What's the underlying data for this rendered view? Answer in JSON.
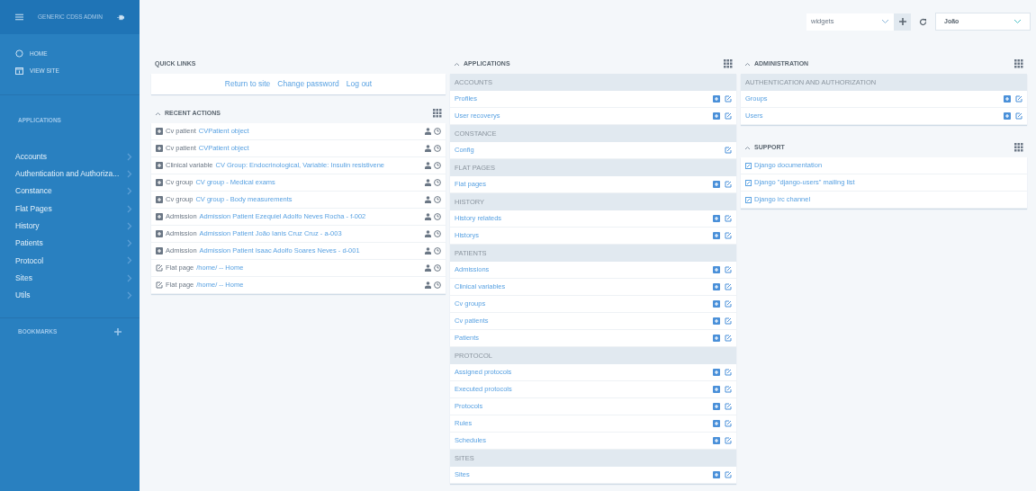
{
  "sidebar": {
    "title": "GENERIC CDSS ADMIN",
    "nav": [
      {
        "label": "HOME",
        "kind": "home"
      },
      {
        "label": "VIEW SITE",
        "kind": "site"
      }
    ],
    "apps_heading": "APPLICATIONS",
    "apps": [
      "Accounts",
      "Authentication and Authoriza...",
      "Constance",
      "Flat Pages",
      "History",
      "Patients",
      "Protocol",
      "Sites",
      "Utils"
    ],
    "bookmarks_heading": "BOOKMARKS"
  },
  "topbar": {
    "widgets_select": "widgets",
    "user_select": "João"
  },
  "quick_links": {
    "title": "QUICK LINKS",
    "links": [
      "Return to site",
      "Change password",
      "Log out"
    ]
  },
  "recent_actions": {
    "title": "RECENT ACTIONS",
    "rows": [
      {
        "kind": "add",
        "type": "Cv patient",
        "object": "CVPatient object"
      },
      {
        "kind": "add",
        "type": "Cv patient",
        "object": "CVPatient object"
      },
      {
        "kind": "add",
        "type": "Clinical variable",
        "object": "CV Group: Endocrinological, Variable: Insulin resistivene"
      },
      {
        "kind": "add",
        "type": "Cv group",
        "object": "CV group - Medical exams"
      },
      {
        "kind": "add",
        "type": "Cv group",
        "object": "CV group - Body measurements"
      },
      {
        "kind": "add",
        "type": "Admission",
        "object": "Admission Patient Ezequiel Adolfo Neves Rocha - f-002"
      },
      {
        "kind": "add",
        "type": "Admission",
        "object": "Admission Patient João Ianis Cruz Cruz - a-003"
      },
      {
        "kind": "add",
        "type": "Admission",
        "object": "Admission Patient Isaac Adolfo Soares Neves - d-001"
      },
      {
        "kind": "change",
        "type": "Flat page",
        "object": "/home/ -- Home"
      },
      {
        "kind": "change",
        "type": "Flat page",
        "object": "/home/ -- Home"
      }
    ]
  },
  "applications": {
    "title": "APPLICATIONS",
    "groups": [
      {
        "name": "ACCOUNTS",
        "models": [
          {
            "label": "Profiles",
            "can_add": true
          },
          {
            "label": "User recoverys",
            "can_add": true
          }
        ]
      },
      {
        "name": "CONSTANCE",
        "models": [
          {
            "label": "Config",
            "can_add": false
          }
        ]
      },
      {
        "name": "FLAT PAGES",
        "models": [
          {
            "label": "Flat pages",
            "can_add": true
          }
        ]
      },
      {
        "name": "HISTORY",
        "models": [
          {
            "label": "History relateds",
            "can_add": true
          },
          {
            "label": "Historys",
            "can_add": true
          }
        ]
      },
      {
        "name": "PATIENTS",
        "models": [
          {
            "label": "Admissions",
            "can_add": true
          },
          {
            "label": "Clinical variables",
            "can_add": true
          },
          {
            "label": "Cv groups",
            "can_add": true
          },
          {
            "label": "Cv patients",
            "can_add": true
          },
          {
            "label": "Patients",
            "can_add": true
          }
        ]
      },
      {
        "name": "PROTOCOL",
        "models": [
          {
            "label": "Assigned protocols",
            "can_add": true
          },
          {
            "label": "Executed protocols",
            "can_add": true
          },
          {
            "label": "Protocols",
            "can_add": true
          },
          {
            "label": "Rules",
            "can_add": true
          },
          {
            "label": "Schedules",
            "can_add": true
          }
        ]
      },
      {
        "name": "SITES",
        "models": [
          {
            "label": "Sites",
            "can_add": true
          }
        ]
      }
    ]
  },
  "administration": {
    "title": "ADMINISTRATION",
    "groups": [
      {
        "name": "AUTHENTICATION AND AUTHORIZATION",
        "models": [
          {
            "label": "Groups",
            "can_add": true
          },
          {
            "label": "Users",
            "can_add": true
          }
        ]
      }
    ]
  },
  "support": {
    "title": "SUPPORT",
    "links": [
      "Django documentation",
      "Django \"django-users\" mailing list",
      "Django irc channel"
    ]
  }
}
